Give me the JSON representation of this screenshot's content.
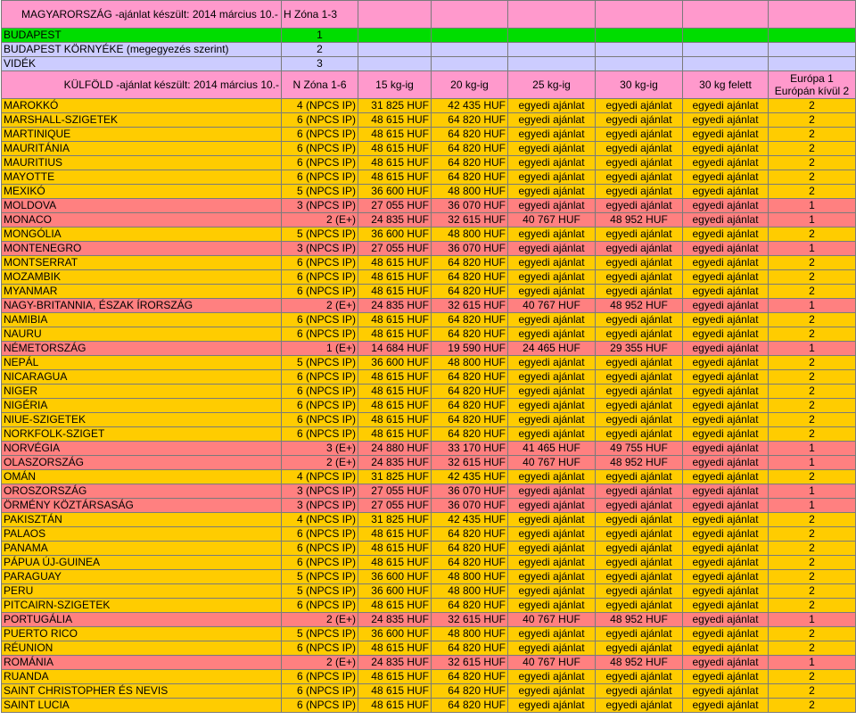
{
  "title": "MAGYARORSZÁG -ajánlat készült: 2014 március 10.-",
  "hu_zone_label": "H Zóna 1-3",
  "domestic_zones": [
    {
      "name": "BUDAPEST",
      "zone": "1"
    },
    {
      "name": "BUDAPEST KÖRNYÉKE (megegyezés szerint)",
      "zone": "2"
    },
    {
      "name": "VIDÉK",
      "zone": "3"
    }
  ],
  "intl_header": {
    "title": "KÜLFÖLD -ajánlat készült: 2014 március 10.-",
    "zone": "N Zóna 1-6",
    "w15": "15 kg-ig",
    "w20": "20 kg-ig",
    "w25": "25 kg-ig",
    "w30": "30 kg-ig",
    "w30plus": "30 kg felett",
    "europe": "Európa 1",
    "non_europe": "Európán kívül 2"
  },
  "colors": {
    "pink": "#ff99cc",
    "green": "#00dd00",
    "lavender": "#ccccff",
    "orange": "#ffcc00",
    "red": "#ff8080"
  },
  "countries": [
    {
      "name": "MAROKKÓ",
      "zone": "4 (NPCS IP)",
      "w15": "31 825 HUF",
      "w20": "42 435 HUF",
      "w25": "egyedi ajánlat",
      "w30": "egyedi ajánlat",
      "w30plus": "egyedi ajánlat",
      "region": "2"
    },
    {
      "name": "MARSHALL-SZIGETEK",
      "zone": "6 (NPCS IP)",
      "w15": "48 615 HUF",
      "w20": "64 820 HUF",
      "w25": "egyedi ajánlat",
      "w30": "egyedi ajánlat",
      "w30plus": "egyedi ajánlat",
      "region": "2"
    },
    {
      "name": "MARTINIQUE",
      "zone": "6 (NPCS IP)",
      "w15": "48 615 HUF",
      "w20": "64 820 HUF",
      "w25": "egyedi ajánlat",
      "w30": "egyedi ajánlat",
      "w30plus": "egyedi ajánlat",
      "region": "2"
    },
    {
      "name": "MAURITÁNIA",
      "zone": "6 (NPCS IP)",
      "w15": "48 615 HUF",
      "w20": "64 820 HUF",
      "w25": "egyedi ajánlat",
      "w30": "egyedi ajánlat",
      "w30plus": "egyedi ajánlat",
      "region": "2"
    },
    {
      "name": "MAURITIUS",
      "zone": "6 (NPCS IP)",
      "w15": "48 615 HUF",
      "w20": "64 820 HUF",
      "w25": "egyedi ajánlat",
      "w30": "egyedi ajánlat",
      "w30plus": "egyedi ajánlat",
      "region": "2"
    },
    {
      "name": "MAYOTTE",
      "zone": "6 (NPCS IP)",
      "w15": "48 615 HUF",
      "w20": "64 820 HUF",
      "w25": "egyedi ajánlat",
      "w30": "egyedi ajánlat",
      "w30plus": "egyedi ajánlat",
      "region": "2"
    },
    {
      "name": "MEXIKÓ",
      "zone": "5 (NPCS IP)",
      "w15": "36 600 HUF",
      "w20": "48 800 HUF",
      "w25": "egyedi ajánlat",
      "w30": "egyedi ajánlat",
      "w30plus": "egyedi ajánlat",
      "region": "2"
    },
    {
      "name": "MOLDOVA",
      "zone": "3 (NPCS IP)",
      "w15": "27 055 HUF",
      "w20": "36 070 HUF",
      "w25": "egyedi ajánlat",
      "w30": "egyedi ajánlat",
      "w30plus": "egyedi ajánlat",
      "region": "1"
    },
    {
      "name": "MONACO",
      "zone": "2 (E+)",
      "w15": "24 835 HUF",
      "w20": "32 615 HUF",
      "w25": "40 767 HUF",
      "w30": "48 952 HUF",
      "w30plus": "egyedi ajánlat",
      "region": "1"
    },
    {
      "name": "MONGÓLIA",
      "zone": "5 (NPCS IP)",
      "w15": "36 600 HUF",
      "w20": "48 800 HUF",
      "w25": "egyedi ajánlat",
      "w30": "egyedi ajánlat",
      "w30plus": "egyedi ajánlat",
      "region": "2"
    },
    {
      "name": "MONTENEGRO",
      "zone": "3 (NPCS IP)",
      "w15": "27 055 HUF",
      "w20": "36 070 HUF",
      "w25": "egyedi ajánlat",
      "w30": "egyedi ajánlat",
      "w30plus": "egyedi ajánlat",
      "region": "1"
    },
    {
      "name": "MONTSERRAT",
      "zone": "6 (NPCS IP)",
      "w15": "48 615 HUF",
      "w20": "64 820 HUF",
      "w25": "egyedi ajánlat",
      "w30": "egyedi ajánlat",
      "w30plus": "egyedi ajánlat",
      "region": "2"
    },
    {
      "name": "MOZAMBIK",
      "zone": "6 (NPCS IP)",
      "w15": "48 615 HUF",
      "w20": "64 820 HUF",
      "w25": "egyedi ajánlat",
      "w30": "egyedi ajánlat",
      "w30plus": "egyedi ajánlat",
      "region": "2"
    },
    {
      "name": "MYANMAR",
      "zone": "6 (NPCS IP)",
      "w15": "48 615 HUF",
      "w20": "64 820 HUF",
      "w25": "egyedi ajánlat",
      "w30": "egyedi ajánlat",
      "w30plus": "egyedi ajánlat",
      "region": "2"
    },
    {
      "name": "NAGY-BRITANNIA, ÉSZAK ÍRORSZÁG",
      "zone": "2 (E+)",
      "w15": "24 835 HUF",
      "w20": "32 615 HUF",
      "w25": "40 767 HUF",
      "w30": "48 952 HUF",
      "w30plus": "egyedi ajánlat",
      "region": "1"
    },
    {
      "name": "NAMIBIA",
      "zone": "6 (NPCS IP)",
      "w15": "48 615 HUF",
      "w20": "64 820 HUF",
      "w25": "egyedi ajánlat",
      "w30": "egyedi ajánlat",
      "w30plus": "egyedi ajánlat",
      "region": "2"
    },
    {
      "name": "NAURU",
      "zone": "6 (NPCS IP)",
      "w15": "48 615 HUF",
      "w20": "64 820 HUF",
      "w25": "egyedi ajánlat",
      "w30": "egyedi ajánlat",
      "w30plus": "egyedi ajánlat",
      "region": "2"
    },
    {
      "name": "NÉMETORSZÁG",
      "zone": "1 (E+)",
      "w15": "14 684 HUF",
      "w20": "19 590 HUF",
      "w25": "24 465 HUF",
      "w30": "29 355 HUF",
      "w30plus": "egyedi ajánlat",
      "region": "1"
    },
    {
      "name": "NEPÁL",
      "zone": "5 (NPCS IP)",
      "w15": "36 600 HUF",
      "w20": "48 800 HUF",
      "w25": "egyedi ajánlat",
      "w30": "egyedi ajánlat",
      "w30plus": "egyedi ajánlat",
      "region": "2"
    },
    {
      "name": "NICARAGUA",
      "zone": "6 (NPCS IP)",
      "w15": "48 615 HUF",
      "w20": "64 820 HUF",
      "w25": "egyedi ajánlat",
      "w30": "egyedi ajánlat",
      "w30plus": "egyedi ajánlat",
      "region": "2"
    },
    {
      "name": "NIGER",
      "zone": "6 (NPCS IP)",
      "w15": "48 615 HUF",
      "w20": "64 820 HUF",
      "w25": "egyedi ajánlat",
      "w30": "egyedi ajánlat",
      "w30plus": "egyedi ajánlat",
      "region": "2"
    },
    {
      "name": "NIGÉRIA",
      "zone": "6 (NPCS IP)",
      "w15": "48 615 HUF",
      "w20": "64 820 HUF",
      "w25": "egyedi ajánlat",
      "w30": "egyedi ajánlat",
      "w30plus": "egyedi ajánlat",
      "region": "2"
    },
    {
      "name": "NIUE-SZIGETEK",
      "zone": "6 (NPCS IP)",
      "w15": "48 615 HUF",
      "w20": "64 820 HUF",
      "w25": "egyedi ajánlat",
      "w30": "egyedi ajánlat",
      "w30plus": "egyedi ajánlat",
      "region": "2"
    },
    {
      "name": "NORKFOLK-SZIGET",
      "zone": "6 (NPCS IP)",
      "w15": "48 615 HUF",
      "w20": "64 820 HUF",
      "w25": "egyedi ajánlat",
      "w30": "egyedi ajánlat",
      "w30plus": "egyedi ajánlat",
      "region": "2"
    },
    {
      "name": "NORVÉGIA",
      "zone": "3 (E+)",
      "w15": "24 880 HUF",
      "w20": "33 170 HUF",
      "w25": "41 465 HUF",
      "w30": "49 755 HUF",
      "w30plus": "egyedi ajánlat",
      "region": "1"
    },
    {
      "name": "OLASZORSZÁG",
      "zone": "2 (E+)",
      "w15": "24 835 HUF",
      "w20": "32 615 HUF",
      "w25": "40 767 HUF",
      "w30": "48 952 HUF",
      "w30plus": "egyedi ajánlat",
      "region": "1"
    },
    {
      "name": "OMÁN",
      "zone": "4 (NPCS IP)",
      "w15": "31 825 HUF",
      "w20": "42 435 HUF",
      "w25": "egyedi ajánlat",
      "w30": "egyedi ajánlat",
      "w30plus": "egyedi ajánlat",
      "region": "2"
    },
    {
      "name": "OROSZORSZÁG",
      "zone": "3 (NPCS IP)",
      "w15": "27 055 HUF",
      "w20": "36 070 HUF",
      "w25": "egyedi ajánlat",
      "w30": "egyedi ajánlat",
      "w30plus": "egyedi ajánlat",
      "region": "1"
    },
    {
      "name": "ÖRMÉNY KÖZTÁRSASÁG",
      "zone": "3 (NPCS IP)",
      "w15": "27 055 HUF",
      "w20": "36 070 HUF",
      "w25": "egyedi ajánlat",
      "w30": "egyedi ajánlat",
      "w30plus": "egyedi ajánlat",
      "region": "1"
    },
    {
      "name": "PAKISZTÁN",
      "zone": "4 (NPCS IP)",
      "w15": "31 825 HUF",
      "w20": "42 435 HUF",
      "w25": "egyedi ajánlat",
      "w30": "egyedi ajánlat",
      "w30plus": "egyedi ajánlat",
      "region": "2"
    },
    {
      "name": "PALAOS",
      "zone": "6 (NPCS IP)",
      "w15": "48 615 HUF",
      "w20": "64 820 HUF",
      "w25": "egyedi ajánlat",
      "w30": "egyedi ajánlat",
      "w30plus": "egyedi ajánlat",
      "region": "2"
    },
    {
      "name": "PANAMA",
      "zone": "6 (NPCS IP)",
      "w15": "48 615 HUF",
      "w20": "64 820 HUF",
      "w25": "egyedi ajánlat",
      "w30": "egyedi ajánlat",
      "w30plus": "egyedi ajánlat",
      "region": "2"
    },
    {
      "name": "PÁPUA ÚJ-GUINEA",
      "zone": "6 (NPCS IP)",
      "w15": "48 615 HUF",
      "w20": "64 820 HUF",
      "w25": "egyedi ajánlat",
      "w30": "egyedi ajánlat",
      "w30plus": "egyedi ajánlat",
      "region": "2"
    },
    {
      "name": "PARAGUAY",
      "zone": "5 (NPCS IP)",
      "w15": "36 600 HUF",
      "w20": "48 800 HUF",
      "w25": "egyedi ajánlat",
      "w30": "egyedi ajánlat",
      "w30plus": "egyedi ajánlat",
      "region": "2"
    },
    {
      "name": "PERU",
      "zone": "5 (NPCS IP)",
      "w15": "36 600 HUF",
      "w20": "48 800 HUF",
      "w25": "egyedi ajánlat",
      "w30": "egyedi ajánlat",
      "w30plus": "egyedi ajánlat",
      "region": "2"
    },
    {
      "name": "PITCAIRN-SZIGETEK",
      "zone": "6 (NPCS IP)",
      "w15": "48 615 HUF",
      "w20": "64 820 HUF",
      "w25": "egyedi ajánlat",
      "w30": "egyedi ajánlat",
      "w30plus": "egyedi ajánlat",
      "region": "2"
    },
    {
      "name": "PORTUGÁLIA",
      "zone": "2 (E+)",
      "w15": "24 835 HUF",
      "w20": "32 615 HUF",
      "w25": "40 767 HUF",
      "w30": "48 952 HUF",
      "w30plus": "egyedi ajánlat",
      "region": "1"
    },
    {
      "name": "PUERTO RICO",
      "zone": "5 (NPCS IP)",
      "w15": "36 600 HUF",
      "w20": "48 800 HUF",
      "w25": "egyedi ajánlat",
      "w30": "egyedi ajánlat",
      "w30plus": "egyedi ajánlat",
      "region": "2"
    },
    {
      "name": "RÉUNION",
      "zone": "6 (NPCS IP)",
      "w15": "48 615 HUF",
      "w20": "64 820 HUF",
      "w25": "egyedi ajánlat",
      "w30": "egyedi ajánlat",
      "w30plus": "egyedi ajánlat",
      "region": "2"
    },
    {
      "name": "ROMÁNIA",
      "zone": "2 (E+)",
      "w15": "24 835 HUF",
      "w20": "32 615 HUF",
      "w25": "40 767 HUF",
      "w30": "48 952 HUF",
      "w30plus": "egyedi ajánlat",
      "region": "1"
    },
    {
      "name": "RUANDA",
      "zone": "6 (NPCS IP)",
      "w15": "48 615 HUF",
      "w20": "64 820 HUF",
      "w25": "egyedi ajánlat",
      "w30": "egyedi ajánlat",
      "w30plus": "egyedi ajánlat",
      "region": "2"
    },
    {
      "name": "SAINT CHRISTOPHER ÉS NEVIS",
      "zone": "6 (NPCS IP)",
      "w15": "48 615 HUF",
      "w20": "64 820 HUF",
      "w25": "egyedi ajánlat",
      "w30": "egyedi ajánlat",
      "w30plus": "egyedi ajánlat",
      "region": "2"
    },
    {
      "name": "SAINT LUCIA",
      "zone": "6 (NPCS IP)",
      "w15": "48 615 HUF",
      "w20": "64 820 HUF",
      "w25": "egyedi ajánlat",
      "w30": "egyedi ajánlat",
      "w30plus": "egyedi ajánlat",
      "region": "2"
    }
  ]
}
